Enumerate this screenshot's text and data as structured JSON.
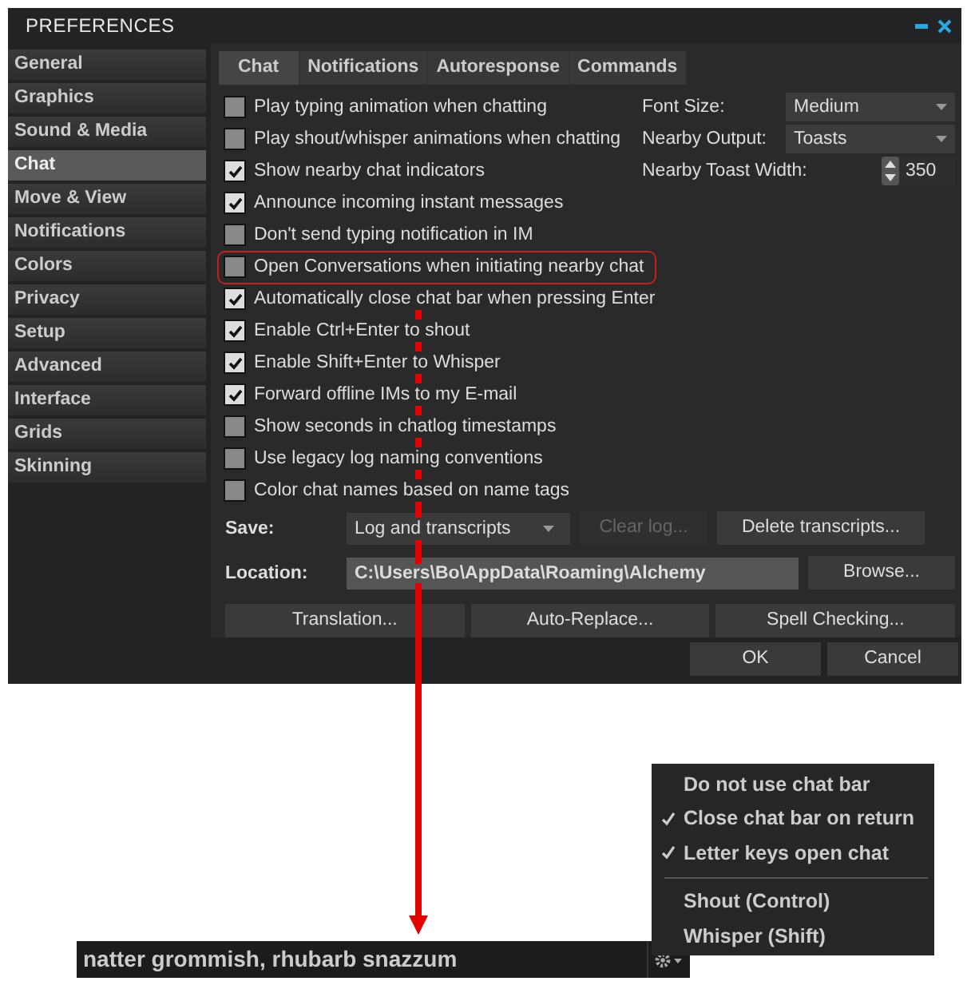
{
  "window": {
    "title": "PREFERENCES"
  },
  "sidebar": {
    "items": [
      {
        "label": "General",
        "selected": false
      },
      {
        "label": "Graphics",
        "selected": false
      },
      {
        "label": "Sound & Media",
        "selected": false
      },
      {
        "label": "Chat",
        "selected": true
      },
      {
        "label": "Move & View",
        "selected": false
      },
      {
        "label": "Notifications",
        "selected": false
      },
      {
        "label": "Colors",
        "selected": false
      },
      {
        "label": "Privacy",
        "selected": false
      },
      {
        "label": "Setup",
        "selected": false
      },
      {
        "label": "Advanced",
        "selected": false
      },
      {
        "label": "Interface",
        "selected": false
      },
      {
        "label": "Grids",
        "selected": false
      },
      {
        "label": "Skinning",
        "selected": false
      }
    ]
  },
  "tabs": [
    {
      "label": "Chat",
      "selected": true
    },
    {
      "label": "Notifications",
      "selected": false
    },
    {
      "label": "Autoresponse",
      "selected": false
    },
    {
      "label": "Commands",
      "selected": false
    }
  ],
  "options": [
    {
      "label": "Play typing animation when chatting",
      "checked": false,
      "highlighted": false
    },
    {
      "label": "Play shout/whisper animations when chatting",
      "checked": false,
      "highlighted": false
    },
    {
      "label": "Show nearby chat indicators",
      "checked": true,
      "highlighted": false
    },
    {
      "label": "Announce incoming instant messages",
      "checked": true,
      "highlighted": false
    },
    {
      "label": "Don't send typing notification in IM",
      "checked": false,
      "highlighted": false
    },
    {
      "label": "Open Conversations when initiating nearby chat",
      "checked": false,
      "highlighted": true
    },
    {
      "label": "Automatically close chat bar when pressing Enter",
      "checked": true,
      "highlighted": false
    },
    {
      "label": "Enable Ctrl+Enter to shout",
      "checked": true,
      "highlighted": false
    },
    {
      "label": "Enable Shift+Enter to Whisper",
      "checked": true,
      "highlighted": false
    },
    {
      "label": "Forward offline IMs to my E-mail",
      "checked": true,
      "highlighted": false
    },
    {
      "label": "Show seconds in chatlog timestamps",
      "checked": false,
      "highlighted": false
    },
    {
      "label": "Use legacy log naming conventions",
      "checked": false,
      "highlighted": false
    },
    {
      "label": "Color chat names based on name tags",
      "checked": false,
      "highlighted": false
    }
  ],
  "settings": [
    {
      "label": "Font Size:",
      "kind": "dropdown",
      "value": "Medium"
    },
    {
      "label": "Nearby Output:",
      "kind": "dropdown",
      "value": "Toasts"
    },
    {
      "label": "Nearby Toast Width:",
      "kind": "spinner",
      "value": "350"
    }
  ],
  "save": {
    "label": "Save:",
    "value": "Log and transcripts",
    "buttons": [
      {
        "label": "Clear log...",
        "disabled": true
      },
      {
        "label": "Delete transcripts...",
        "disabled": false
      }
    ]
  },
  "location": {
    "label": "Location:",
    "value": "C:\\Users\\Bo\\AppData\\Roaming\\Alchemy",
    "button": "Browse..."
  },
  "action_buttons": [
    "Translation...",
    "Auto-Replace...",
    "Spell Checking..."
  ],
  "dialog_buttons": [
    "OK",
    "Cancel"
  ],
  "chat_bar": {
    "value": "natter grommish, rhubarb snazzum"
  },
  "chat_menu": {
    "groups": [
      [
        {
          "label": "Do not use chat bar",
          "checked": false
        },
        {
          "label": "Close chat bar on return",
          "checked": true
        },
        {
          "label": "Letter keys open chat",
          "checked": true
        }
      ],
      [
        {
          "label": "Shout (Control)",
          "checked": false
        },
        {
          "label": "Whisper (Shift)",
          "checked": false
        }
      ]
    ]
  }
}
